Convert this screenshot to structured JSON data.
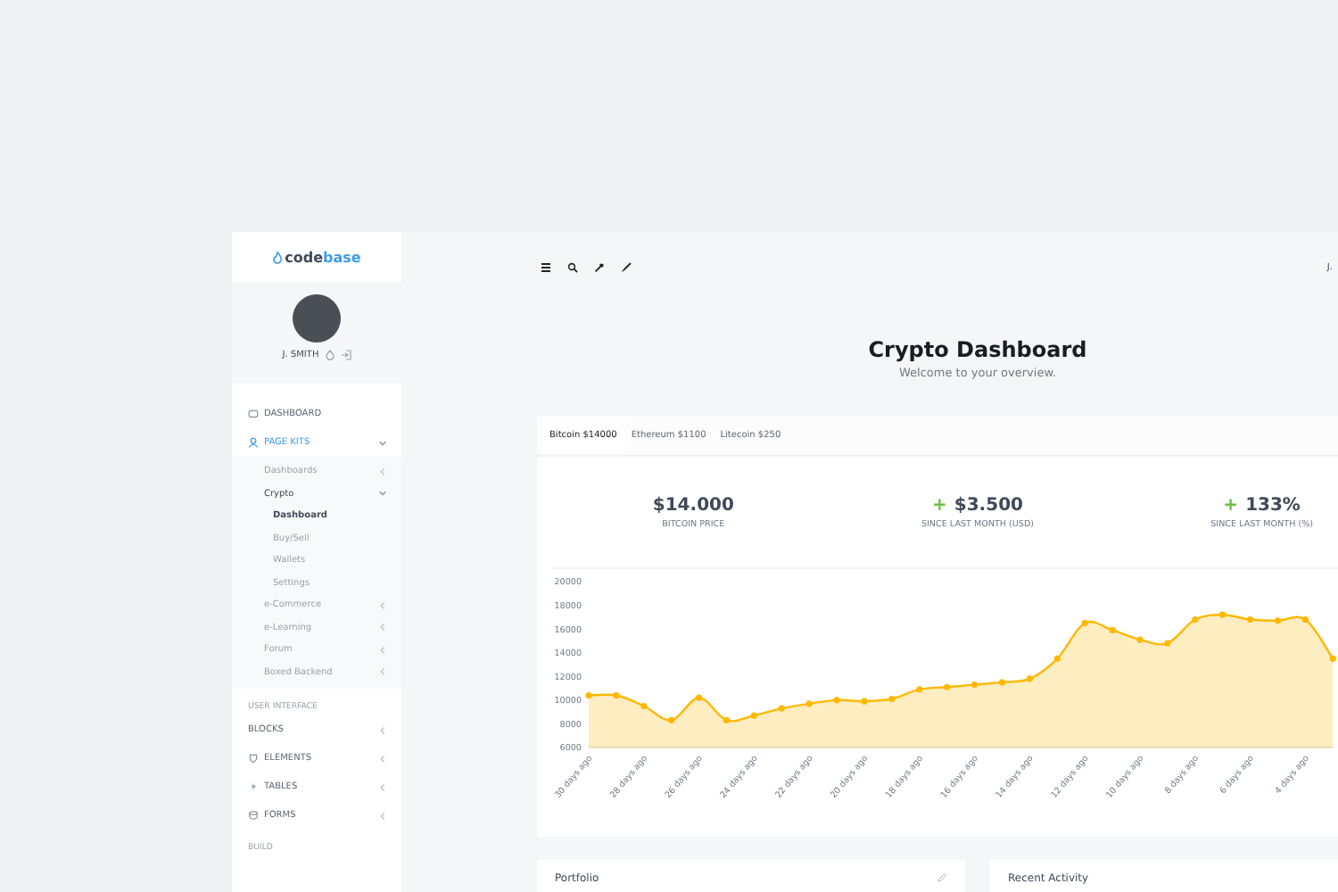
{
  "sidebar": {
    "logo": {
      "part_1": "code",
      "part_2": "base"
    },
    "user": "J. SMITH",
    "nav": [
      {
        "kind": "item",
        "label": "DASHBOARD",
        "selected": false
      },
      {
        "kind": "item",
        "label": "PAGE KITS",
        "selected": true,
        "expanded": true,
        "children": [
          {
            "label": "Dashboards",
            "selected": false,
            "expanded": false
          },
          {
            "label": "Crypto",
            "selected": true,
            "expanded": true,
            "children": [
              {
                "label": "Dashboard",
                "selected": true
              },
              {
                "label": "Buy/Sell",
                "selected": false
              },
              {
                "label": "Wallets",
                "selected": false
              },
              {
                "label": "Settings",
                "selected": false
              }
            ]
          },
          {
            "label": "e-Commerce",
            "selected": false,
            "expanded": false
          },
          {
            "label": "e-Learning",
            "selected": false,
            "expanded": false
          },
          {
            "label": "Forum",
            "selected": false,
            "expanded": false
          },
          {
            "label": "Boxed Backend",
            "selected": false,
            "expanded": false
          }
        ]
      },
      {
        "kind": "heading",
        "label": "USER INTERFACE"
      },
      {
        "kind": "item",
        "label": "BLOCKS",
        "selected": false,
        "expanded": false
      },
      {
        "kind": "item",
        "label": "ELEMENTS",
        "selected": false,
        "expanded": false
      },
      {
        "kind": "item",
        "label": "TABLES",
        "selected": false,
        "expanded": false
      },
      {
        "kind": "item",
        "label": "FORMS",
        "selected": false,
        "expanded": false
      },
      {
        "kind": "heading",
        "label": "BUILD"
      }
    ]
  },
  "topbar": {
    "user": "J."
  },
  "header": {
    "title": "Crypto Dashboard",
    "subtitle": "Welcome to your overview."
  },
  "tabs": [
    {
      "label": "Bitcoin $14000",
      "selected": true
    },
    {
      "label": "Ethereum $1100",
      "selected": false
    },
    {
      "label": "Litecoin $250",
      "selected": false
    }
  ],
  "stats": [
    {
      "value": "$14.000",
      "label": "BITCOIN PRICE"
    },
    {
      "sign": "+",
      "value": "$3.500",
      "label": "SINCE LAST MONTH (USD)"
    },
    {
      "sign": "+",
      "value": "133%",
      "label": "SINCE LAST MONTH (%)"
    }
  ],
  "chart_data": {
    "type": "area",
    "x": [
      30,
      29,
      28,
      27,
      26,
      25,
      24,
      23,
      22,
      21,
      20,
      19,
      18,
      17,
      16,
      15,
      14,
      13,
      12,
      11,
      10,
      9,
      8,
      7,
      6,
      5,
      4,
      3
    ],
    "xlim": [
      30,
      3
    ],
    "series": [
      {
        "color": "#ffb800",
        "values": [
          10400,
          10400,
          9500,
          8300,
          10200,
          8300,
          8700,
          9300,
          9700,
          10000,
          9900,
          10100,
          10900,
          11100,
          11300,
          11500,
          11800,
          13500,
          16500,
          15900,
          15100,
          14800,
          16800,
          17200,
          16800,
          16700,
          16800,
          13500
        ]
      }
    ],
    "ylim": [
      6000,
      20000
    ],
    "yticks": [
      6000,
      8000,
      10000,
      12000,
      14000,
      16000,
      18000,
      20000
    ],
    "xticks": [
      {
        "value": 30,
        "label": "30 days ago"
      },
      {
        "value": 28,
        "label": "28 days ago"
      },
      {
        "value": 26,
        "label": "26 days ago"
      },
      {
        "value": 24,
        "label": "24 days ago"
      },
      {
        "value": 22,
        "label": "22 days ago"
      },
      {
        "value": 20,
        "label": "20 days ago"
      },
      {
        "value": 18,
        "label": "18 days ago"
      },
      {
        "value": 16,
        "label": "16 days ago"
      },
      {
        "value": 14,
        "label": "14 days ago"
      },
      {
        "value": 12,
        "label": "12 days ago"
      },
      {
        "value": 10,
        "label": "10 days ago"
      },
      {
        "value": 8,
        "label": "8 days ago"
      },
      {
        "value": 6,
        "label": "6 days ago"
      },
      {
        "value": 4,
        "label": "4 days ago"
      }
    ]
  },
  "cards": [
    {
      "title": "Portfolio",
      "editable": true
    },
    {
      "title": "Recent Activity"
    }
  ]
}
